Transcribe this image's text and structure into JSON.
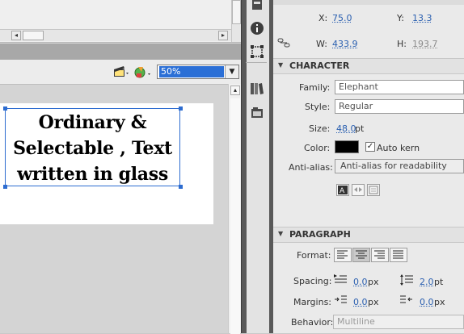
{
  "stage": {
    "zoom": "50%",
    "text_lines": [
      "Ordinary &",
      "Selectable ,  Text",
      "written in glass"
    ]
  },
  "position": {
    "x_label": "X:",
    "x_value": "75.0",
    "y_label": "Y:",
    "y_value": "13.3",
    "w_label": "W:",
    "w_value": "433.9",
    "h_label": "H:",
    "h_value": "193.7"
  },
  "character": {
    "section_title": "CHARACTER",
    "family_label": "Family:",
    "family_value": "Elephant",
    "style_label": "Style:",
    "style_value": "Regular",
    "size_label": "Size:",
    "size_value": "48.0",
    "size_unit": "pt",
    "color_label": "Color:",
    "color_value": "#000000",
    "auto_kern_label": "Auto kern",
    "auto_kern_checked": true,
    "antialias_label": "Anti-alias:",
    "antialias_value": "Anti-alias for readability"
  },
  "paragraph": {
    "section_title": "PARAGRAPH",
    "format_label": "Format:",
    "spacing_label": "Spacing:",
    "spacing_indent": "0.0",
    "spacing_indent_unit": "px",
    "spacing_line": "2.0",
    "spacing_line_unit": "pt",
    "margins_label": "Margins:",
    "margin_left": "0.0",
    "margin_left_unit": "px",
    "margin_right": "0.0",
    "margin_right_unit": "px",
    "behavior_label": "Behavior:",
    "behavior_value": "Multiline"
  },
  "colors": {
    "accent": "#2b6fd6",
    "link_value": "#2a5fb0",
    "selection": "#2d6cd0"
  }
}
